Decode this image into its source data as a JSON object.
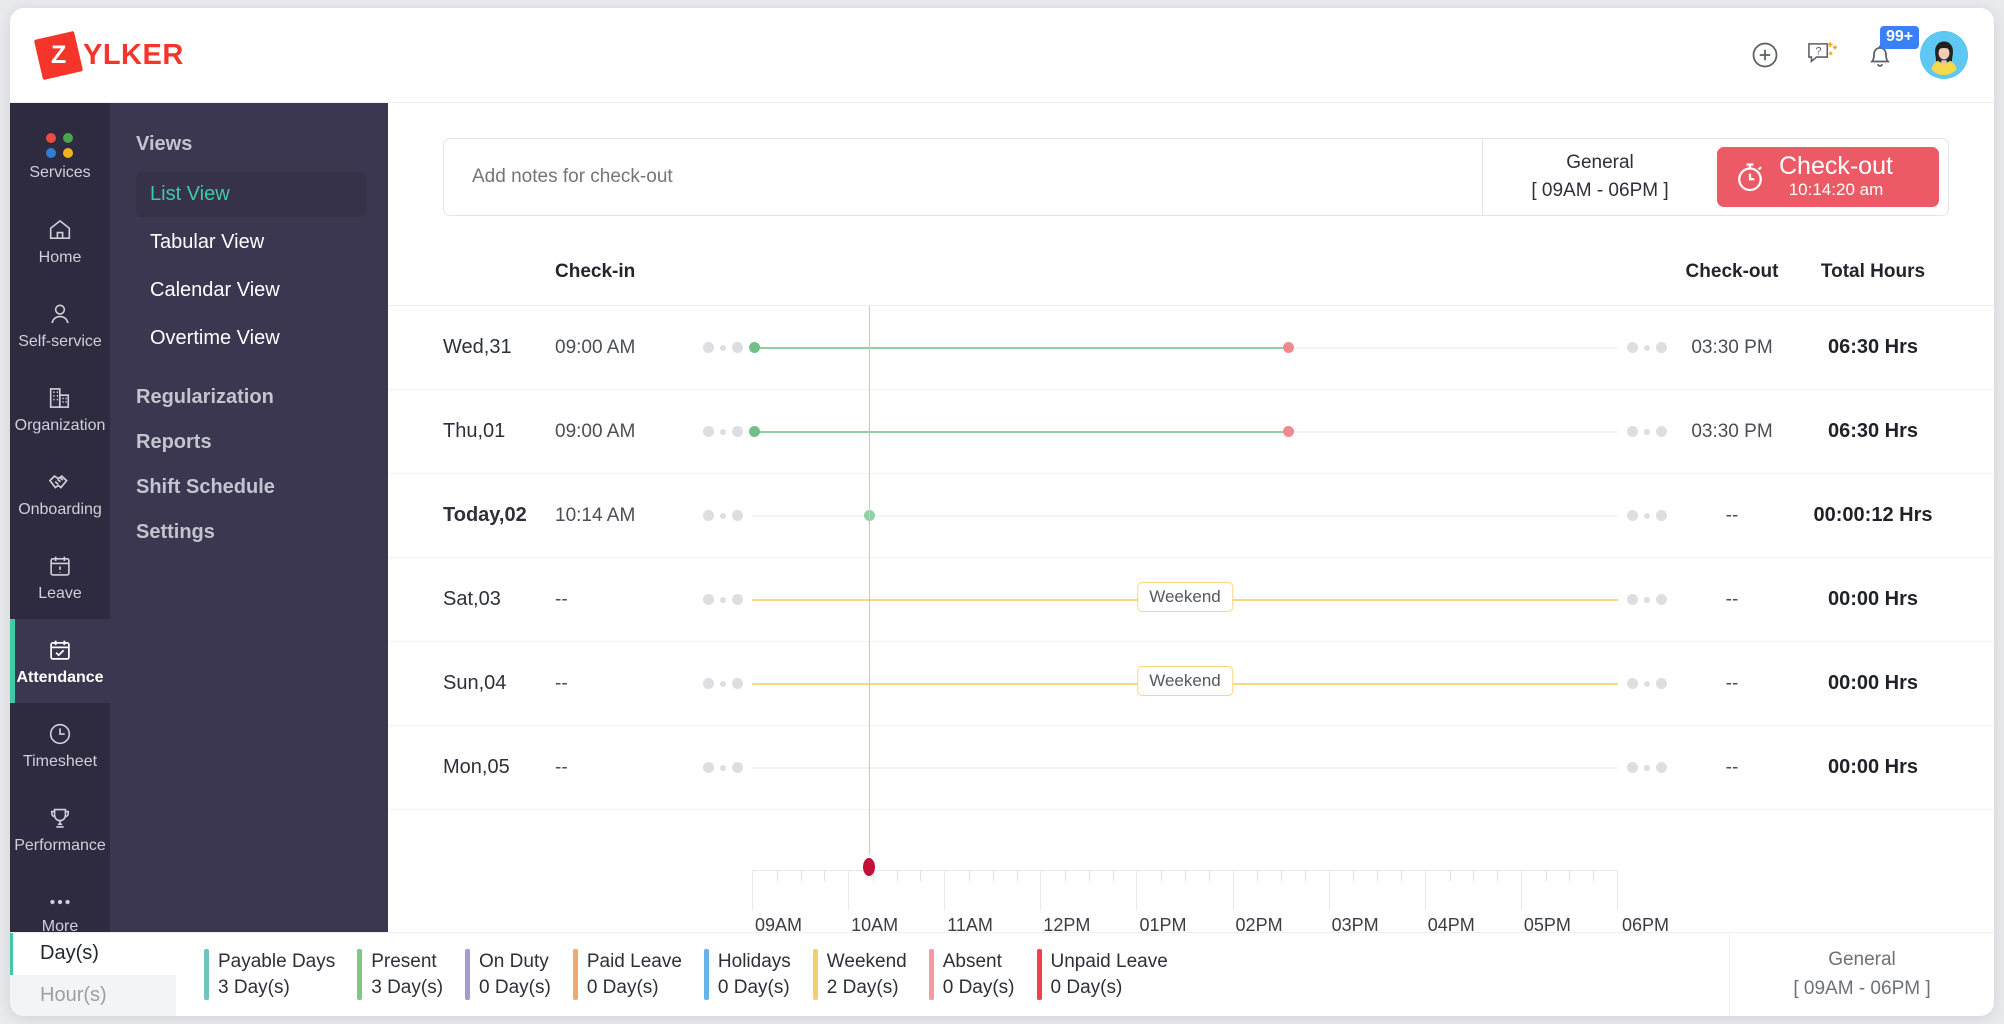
{
  "brand": {
    "mark": "Z",
    "name": "YLKER"
  },
  "topbar": {
    "add_icon": "plus-circle-icon",
    "help_icon": "help-chat-icon",
    "bell_icon": "bell-icon",
    "bell_badge": "99+",
    "avatar": "user-avatar"
  },
  "rail": [
    {
      "label": "Services",
      "icon": "services-dots-icon",
      "active": false
    },
    {
      "label": "Home",
      "icon": "home-icon",
      "active": false
    },
    {
      "label": "Self-service",
      "icon": "user-icon",
      "active": false
    },
    {
      "label": "Organization",
      "icon": "building-icon",
      "active": false
    },
    {
      "label": "Onboarding",
      "icon": "handshake-icon",
      "active": false
    },
    {
      "label": "Leave",
      "icon": "calendar-alert-icon",
      "active": false
    },
    {
      "label": "Attendance",
      "icon": "calendar-check-icon",
      "active": true
    },
    {
      "label": "Timesheet",
      "icon": "clock-icon",
      "active": false
    },
    {
      "label": "Performance",
      "icon": "trophy-icon",
      "active": false
    },
    {
      "label": "More",
      "icon": "ellipsis-icon",
      "active": false
    }
  ],
  "views": {
    "heading": "Views",
    "items": [
      {
        "label": "List View",
        "active": true
      },
      {
        "label": "Tabular View",
        "active": false
      },
      {
        "label": "Calendar View",
        "active": false
      },
      {
        "label": "Overtime View",
        "active": false
      }
    ],
    "groups": [
      {
        "label": "Regularization"
      },
      {
        "label": "Reports"
      },
      {
        "label": "Shift Schedule"
      },
      {
        "label": "Settings"
      }
    ]
  },
  "checkout_bar": {
    "notes_placeholder": "Add notes for check-out",
    "notes_value": "",
    "shift_name": "General",
    "shift_hours": "[ 09AM - 06PM ]",
    "button_label": "Check-out",
    "button_time": "10:14:20 am",
    "button_icon": "stopwatch-icon",
    "button_color": "#ec5a65"
  },
  "table": {
    "headers": {
      "date": "",
      "checkin": "Check-in",
      "track": "",
      "checkout": "Check-out",
      "total": "Total Hours"
    },
    "rows": [
      {
        "date": "Wed,31",
        "checkin": "09:00 AM",
        "checkout": "03:30 PM",
        "total": "06:30 Hrs",
        "type": "worked",
        "today": false,
        "start_pct": 0.0,
        "end_pct": 62.0,
        "chip": ""
      },
      {
        "date": "Thu,01",
        "checkin": "09:00 AM",
        "checkout": "03:30 PM",
        "total": "06:30 Hrs",
        "type": "worked",
        "today": false,
        "start_pct": 0.0,
        "end_pct": 62.0,
        "chip": ""
      },
      {
        "date": "Today,02",
        "checkin": "10:14 AM",
        "checkout": "--",
        "total": "00:00:12 Hrs",
        "type": "today",
        "today": true,
        "start_pct": 13.5,
        "end_pct": 13.5,
        "chip": ""
      },
      {
        "date": "Sat,03",
        "checkin": "--",
        "checkout": "--",
        "total": "00:00 Hrs",
        "type": "weekend",
        "today": false,
        "start_pct": 0.0,
        "end_pct": 100.0,
        "chip": "Weekend"
      },
      {
        "date": "Sun,04",
        "checkin": "--",
        "checkout": "--",
        "total": "00:00 Hrs",
        "type": "weekend",
        "today": false,
        "start_pct": 0.0,
        "end_pct": 100.0,
        "chip": "Weekend"
      },
      {
        "date": "Mon,05",
        "checkin": "--",
        "checkout": "--",
        "total": "00:00 Hrs",
        "type": "empty",
        "today": false,
        "start_pct": 0.0,
        "end_pct": 0.0,
        "chip": ""
      }
    ]
  },
  "axis": {
    "labels": [
      "09AM",
      "10AM",
      "11AM",
      "12PM",
      "01PM",
      "02PM",
      "03PM",
      "04PM",
      "05PM"
    ],
    "end_label": "06PM",
    "now_position_pct": 13.5,
    "now_marker_color": "#c2103a"
  },
  "footer": {
    "unit_tabs": [
      {
        "label": "Day(s)",
        "active": true
      },
      {
        "label": "Hour(s)",
        "active": false
      }
    ],
    "legend": [
      {
        "label": "Payable Days",
        "value": "3 Day(s)",
        "color": "#6fc3c0"
      },
      {
        "label": "Present",
        "value": "3 Day(s)",
        "color": "#78c98a"
      },
      {
        "label": "On Duty",
        "value": "0 Day(s)",
        "color": "#a49ad8"
      },
      {
        "label": "Paid Leave",
        "value": "0 Day(s)",
        "color": "#f4a96a"
      },
      {
        "label": "Holidays",
        "value": "0 Day(s)",
        "color": "#67b2e8"
      },
      {
        "label": "Weekend",
        "value": "2 Day(s)",
        "color": "#f6ce72"
      },
      {
        "label": "Absent",
        "value": "0 Day(s)",
        "color": "#f59aa4"
      },
      {
        "label": "Unpaid Leave",
        "value": "0 Day(s)",
        "color": "#ee414c"
      }
    ],
    "shift_name": "General",
    "shift_hours": "[ 09AM - 06PM ]"
  }
}
